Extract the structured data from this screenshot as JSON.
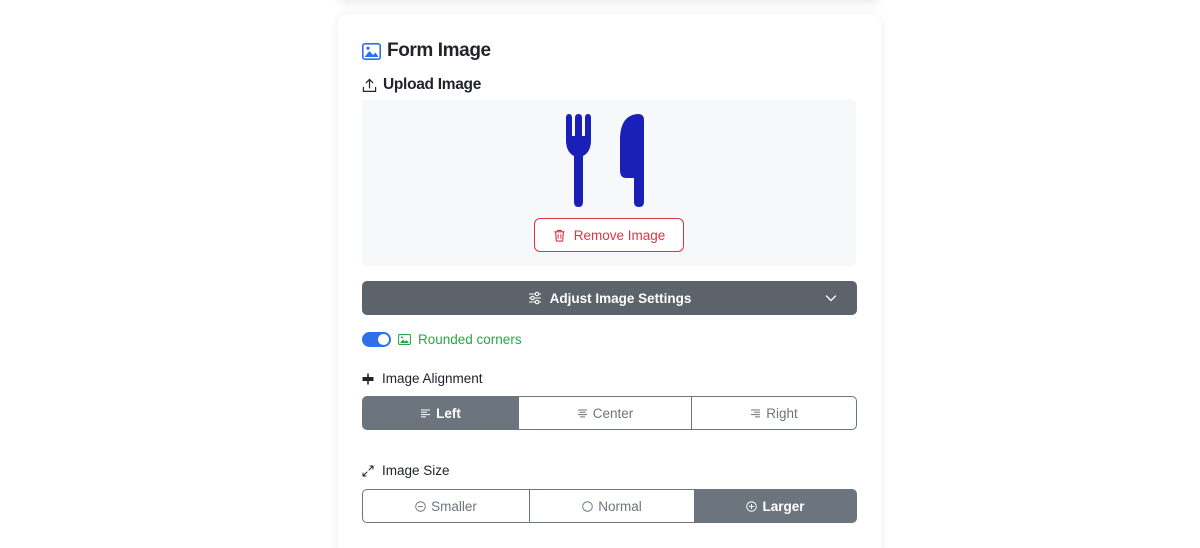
{
  "card": {
    "title": "Form Image",
    "upload_label": "Upload Image",
    "remove_label": "Remove Image"
  },
  "adjust": {
    "label": "Adjust Image Settings"
  },
  "rounded": {
    "label": "Rounded corners",
    "enabled": true
  },
  "alignment": {
    "label": "Image Alignment",
    "options": [
      "Left",
      "Center",
      "Right"
    ],
    "selected": "Left"
  },
  "size": {
    "label": "Image Size",
    "options": [
      "Smaller",
      "Normal",
      "Larger"
    ],
    "selected": "Larger"
  },
  "colors": {
    "accent": "#2f6fed",
    "danger": "#dc3545",
    "success": "#28a745",
    "secondary": "#6c757d",
    "utensils": "#1a1fb8"
  },
  "icons": {
    "title": "image-icon",
    "upload": "upload-icon",
    "preview": "utensils-icon",
    "remove": "trash-icon",
    "adjust": "sliders-icon",
    "expand": "chevron-down-icon",
    "alignment": "align-icon",
    "size": "expand-arrows-icon"
  }
}
